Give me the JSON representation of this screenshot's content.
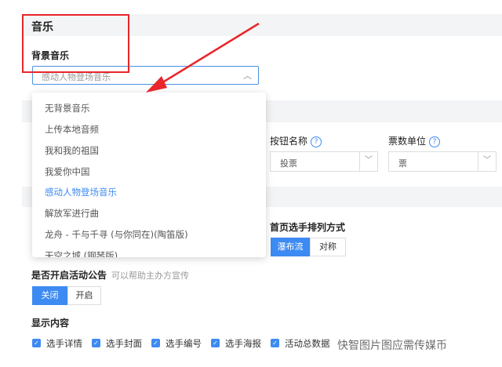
{
  "music": {
    "section_title": "音乐",
    "bgm_label": "背景音乐",
    "bgm_selected": "感动人物登场音乐",
    "options": [
      {
        "label": "无背景音乐",
        "active": false
      },
      {
        "label": "上传本地音频",
        "active": false
      },
      {
        "label": "我和我的祖国",
        "active": false
      },
      {
        "label": "我爱你中国",
        "active": false
      },
      {
        "label": "感动人物登场音乐",
        "active": true
      },
      {
        "label": "解放军进行曲",
        "active": false
      },
      {
        "label": "龙舟 - 千与千寻 (与你同在)(陶笛版)",
        "active": false
      },
      {
        "label": "天空之城 (钢琴版)",
        "active": false
      }
    ]
  },
  "vote": {
    "button_name_label": "按钮名称",
    "button_name_value": "投票",
    "unit_label": "票数单位",
    "unit_value": "票"
  },
  "sort": {
    "label": "首页选手排列方式",
    "options": [
      "瀑布流",
      "对称"
    ],
    "selected": "瀑布流"
  },
  "announcement": {
    "label": "是否开启活动公告",
    "hint": "可以帮助主办方宣传",
    "options": [
      "关闭",
      "开启"
    ],
    "selected": "关闭"
  },
  "display": {
    "label": "显示内容",
    "items": [
      "选手详情",
      "选手封面",
      "选手编号",
      "选手海报",
      "活动总数据"
    ]
  },
  "watermark": "快智图片图应需传媒币",
  "colors": {
    "accent": "#3d8bf2",
    "highlight": "#e8262b"
  }
}
